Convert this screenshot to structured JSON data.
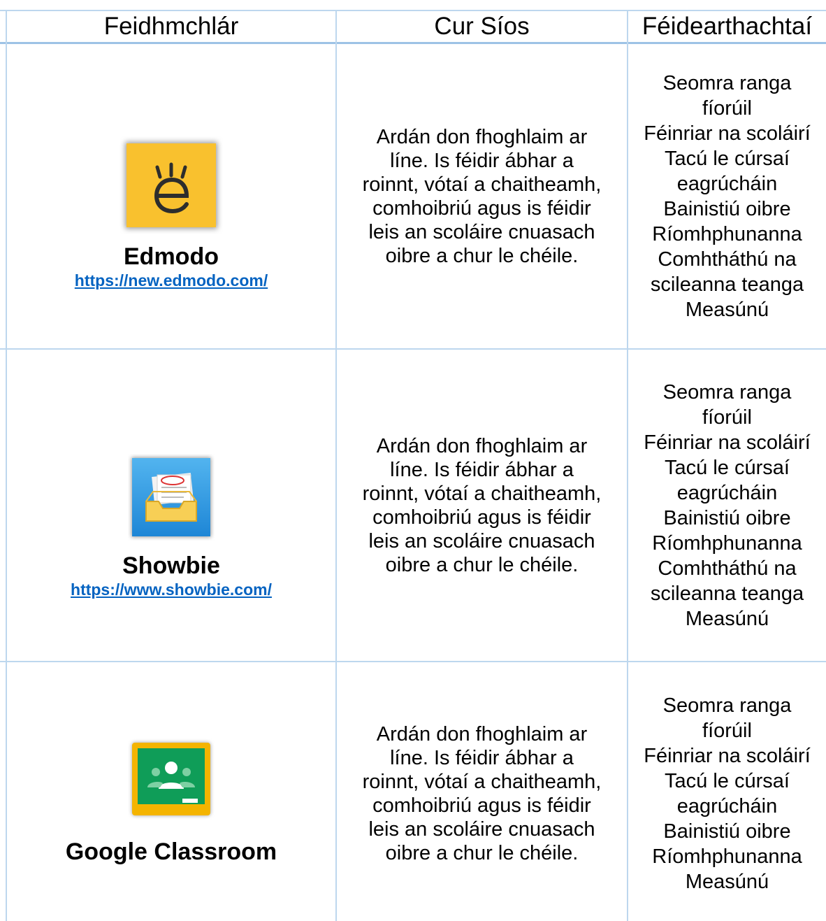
{
  "table": {
    "headers": [
      "Feidhmchlár",
      "Cur Síos",
      "Féidearthachtaí"
    ],
    "rows": [
      {
        "app": "Edmodo",
        "url": "https://new.edmodo.com/",
        "icon": "edmodo-logo",
        "description": [
          "Ardán don fhoghlaim ar",
          "líne. Is féidir ábhar a",
          "roinnt, vótaí a chaitheamh,",
          "comhoibriú agus is féidir",
          "leis an scoláire cnuasach",
          "oibre a chur le chéile."
        ],
        "features": [
          "Seomra ranga",
          "fíorúil",
          "Féinriar na scoláirí",
          "Tacú le cúrsaí",
          "eagrúcháin",
          "Bainistiú oibre",
          "Ríomhphunanna",
          "Comhtháthú na",
          "scileanna teanga",
          "Measúnú"
        ]
      },
      {
        "app": "Showbie",
        "url": "https://www.showbie.com/",
        "icon": "showbie-logo",
        "description": [
          "Ardán don fhoghlaim ar",
          "líne. Is féidir ábhar a",
          "roinnt, vótaí a chaitheamh,",
          "comhoibriú agus is féidir",
          "leis an scoláire cnuasach",
          "oibre a chur le chéile."
        ],
        "features": [
          "Seomra ranga",
          "fíorúil",
          "Féinriar na scoláirí",
          "Tacú le cúrsaí",
          "eagrúcháin",
          "Bainistiú oibre",
          "Ríomhphunanna",
          "Comhtháthú na",
          "scileanna teanga",
          "Measúnú"
        ]
      },
      {
        "app": "Google Classroom",
        "url": "",
        "icon": "google-classroom-logo",
        "description": [
          "Ardán don fhoghlaim ar",
          "líne. Is féidir ábhar a",
          "roinnt, vótaí a chaitheamh,",
          "comhoibriú agus is féidir",
          "leis an scoláire cnuasach",
          "oibre a chur le chéile."
        ],
        "features": [
          "Seomra ranga",
          "fíorúil",
          "Féinriar na scoláirí",
          "Tacú le cúrsaí",
          "eagrúcháin",
          "Bainistiú oibre",
          "Ríomhphunanna",
          "Measúnú"
        ]
      }
    ]
  }
}
